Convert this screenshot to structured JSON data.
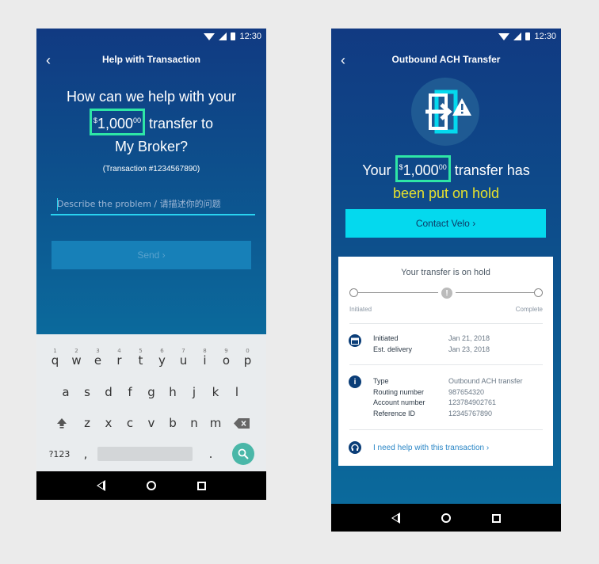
{
  "status": {
    "time": "12:30"
  },
  "help_screen": {
    "title": "Help with Transaction",
    "question_line1": "How can we help with your",
    "amount_currency": "$",
    "amount_main": "1,000",
    "amount_cents": "00",
    "question_after_amount": "transfer to",
    "question_line3": "My Broker?",
    "transaction_ref": "(Transaction #1234567890)",
    "input_placeholder": "Describe the problem / 请描述你的问题",
    "send_label": "Send ›"
  },
  "keyboard": {
    "row1": [
      {
        "num": "1",
        "key": "q"
      },
      {
        "num": "2",
        "key": "w"
      },
      {
        "num": "3",
        "key": "e"
      },
      {
        "num": "4",
        "key": "r"
      },
      {
        "num": "5",
        "key": "t"
      },
      {
        "num": "6",
        "key": "y"
      },
      {
        "num": "7",
        "key": "u"
      },
      {
        "num": "8",
        "key": "i"
      },
      {
        "num": "9",
        "key": "o"
      },
      {
        "num": "0",
        "key": "p"
      }
    ],
    "row2": [
      "a",
      "s",
      "d",
      "f",
      "g",
      "h",
      "j",
      "k",
      "l"
    ],
    "row3": [
      "z",
      "x",
      "c",
      "v",
      "b",
      "n",
      "m"
    ],
    "symbols_key": "?123",
    "comma_key": ",",
    "period_key": ".",
    "shift_icon": "shift-icon",
    "backspace_icon": "backspace-icon",
    "search_icon": "search-icon"
  },
  "transfer_screen": {
    "title": "Outbound ACH Transfer",
    "hero_icon": "transfer-warning-icon",
    "headline_prefix": "Your",
    "amount_currency": "$",
    "amount_main": "1,000",
    "amount_cents": "00",
    "headline_suffix": "transfer has",
    "hold_text": "been put on hold",
    "contact_label": "Contact Velo ›",
    "card": {
      "title": "Your transfer is on hold",
      "step_initiated": "Initiated",
      "step_complete": "Complete",
      "mid_marker": "!",
      "dates": {
        "initiated_label": "Initiated",
        "initiated_value": "Jan 21, 2018",
        "delivery_label": "Est. delivery",
        "delivery_value": "Jan 23, 2018"
      },
      "details": {
        "type_label": "Type",
        "type_value": "Outbound ACH transfer",
        "routing_label": "Routing number",
        "routing_value": "987654320",
        "account_label": "Account number",
        "account_value": "123784902761",
        "ref_label": "Reference ID",
        "ref_value": "12345767890"
      },
      "help_link": "I need help with this transaction ›"
    }
  },
  "colors": {
    "highlight": "#2ee6a6",
    "accent_cyan": "#04d9ee",
    "hold_yellow": "#e4e02e",
    "link_blue": "#2a86c6"
  }
}
